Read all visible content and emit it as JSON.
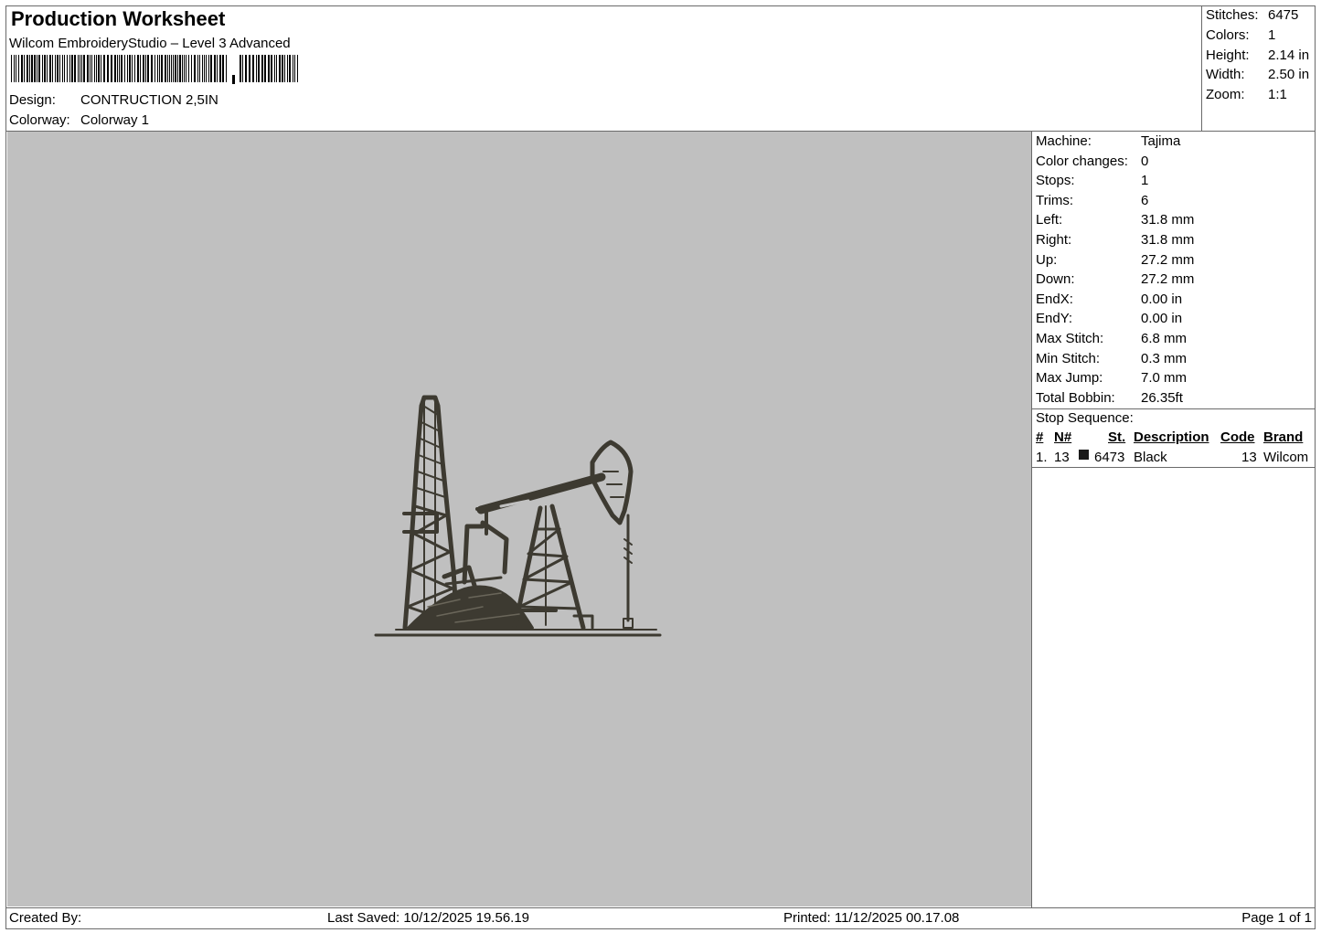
{
  "header": {
    "title": "Production Worksheet",
    "subtitle": "Wilcom EmbroideryStudio – Level 3 Advanced",
    "barcode_label": "barcode",
    "design_label": "Design:",
    "design_value": "CONTRUCTION 2,5IN",
    "colorway_label": "Colorway:",
    "colorway_value": "Colorway 1"
  },
  "summary": {
    "stitches_label": "Stitches:",
    "stitches": "6475",
    "colors_label": "Colors:",
    "colors": "1",
    "height_label": "Height:",
    "height": "2.14 in",
    "width_label": "Width:",
    "width": "2.50 in",
    "zoom_label": "Zoom:",
    "zoom": "1:1"
  },
  "machine_info": [
    {
      "label": "Machine:",
      "value": "Tajima"
    },
    {
      "label": "Color changes:",
      "value": "0"
    },
    {
      "label": "Stops:",
      "value": "1"
    },
    {
      "label": "Trims:",
      "value": "6"
    },
    {
      "label": "Left:",
      "value": "31.8 mm"
    },
    {
      "label": "Right:",
      "value": "31.8 mm"
    },
    {
      "label": "Up:",
      "value": "27.2 mm"
    },
    {
      "label": "Down:",
      "value": "27.2 mm"
    },
    {
      "label": "EndX:",
      "value": "0.00 in"
    },
    {
      "label": "EndY:",
      "value": "0.00 in"
    },
    {
      "label": "Max Stitch:",
      "value": "6.8 mm"
    },
    {
      "label": "Min Stitch:",
      "value": "0.3 mm"
    },
    {
      "label": "Max Jump:",
      "value": "7.0 mm"
    },
    {
      "label": "Total Bobbin:",
      "value": "26.35ft"
    }
  ],
  "stop_sequence": {
    "title": "Stop Sequence:",
    "headers": {
      "num": "#",
      "n": "N#",
      "st": "St.",
      "description": "Description",
      "code": "Code",
      "brand": "Brand"
    },
    "rows": [
      {
        "num": "1.",
        "n": "13",
        "swatch_color": "#1a1a1a",
        "st": "6473",
        "description": "Black",
        "code": "13",
        "brand": "Wilcom"
      }
    ]
  },
  "design_preview": {
    "background_color": "#c0c0c0",
    "thread_color": "#3d3a31",
    "icon": "oil-pumpjack-and-derrick-icon"
  },
  "footer": {
    "created_by": "Created By:",
    "last_saved": "Last Saved: 10/12/2025 19.56.19",
    "printed": "Printed: 11/12/2025 00.17.08",
    "page": "Page 1 of 1"
  }
}
